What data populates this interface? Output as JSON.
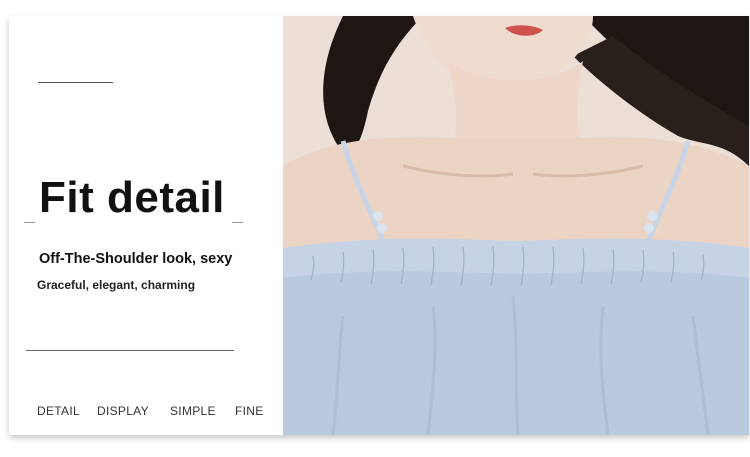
{
  "panel": {
    "title": "Fit detail",
    "subtitle": "Off-The-Shoulder look, sexy",
    "tagline": "Graceful, elegant, charming"
  },
  "nav": {
    "items": [
      "DETAIL",
      "DISPLAY",
      "SIMPLE",
      "FINE"
    ]
  },
  "photo": {
    "subject": "model wearing light blue off-the-shoulder top with thin straps",
    "colors": {
      "top": "#b9c9de",
      "hair": "#1d1613",
      "skin": "#ecd6c7",
      "lips": "#d0524f"
    }
  }
}
